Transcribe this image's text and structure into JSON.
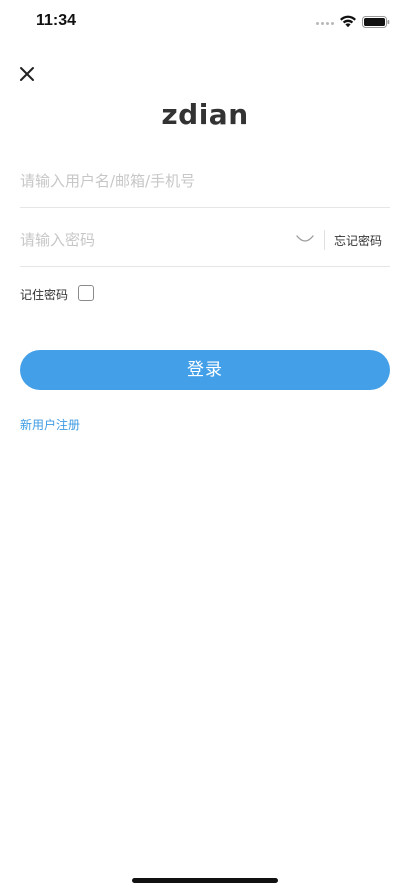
{
  "status_bar": {
    "time": "11:34",
    "icons": [
      "signal-dots-icon",
      "wifi-icon",
      "battery-icon"
    ]
  },
  "header": {
    "close_icon": "close-icon",
    "logo_text": "zdian"
  },
  "form": {
    "username": {
      "value": "",
      "placeholder": "请输入用户名/邮箱/手机号"
    },
    "password": {
      "value": "",
      "placeholder": "请输入密码",
      "visibility_icon": "eye-closed-icon",
      "forgot_label": "忘记密码"
    },
    "remember": {
      "label": "记住密码",
      "checked": false
    },
    "login_label": "登录",
    "register_label": "新用户注册"
  },
  "colors": {
    "accent": "#43a0e8",
    "link": "#3f9be3",
    "placeholder": "#c7c7c7",
    "divider": "#e6e6e6"
  }
}
